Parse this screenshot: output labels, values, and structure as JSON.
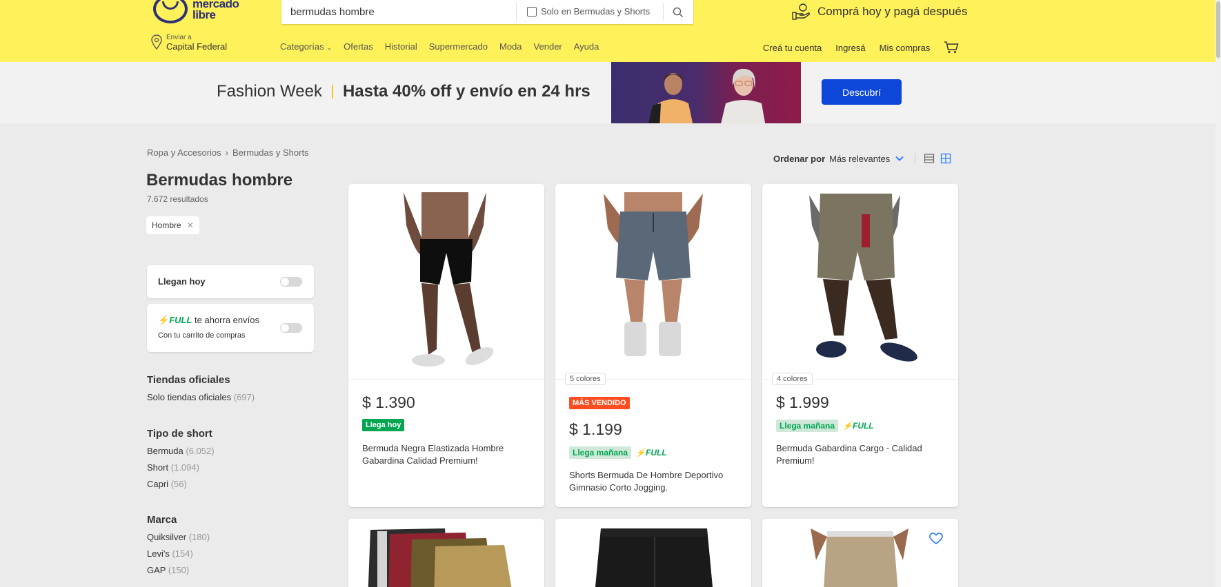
{
  "header": {
    "logo_text_line1": "mercado",
    "logo_text_line2": "libre",
    "search_value": "bermudas hombre",
    "search_filter_label": "Solo en Bermudas y Shorts",
    "promo_text": "Comprá hoy y pagá después",
    "location_label": "Enviar a",
    "location_value": "Capital Federal",
    "nav": [
      "Categorías",
      "Ofertas",
      "Historial",
      "Supermercado",
      "Moda",
      "Vender",
      "Ayuda"
    ],
    "user_nav": [
      "Creá tu cuenta",
      "Ingresá",
      "Mis compras"
    ]
  },
  "banner": {
    "title": "Fashion Week",
    "subtitle": "Hasta 40% off y envío en 24 hrs",
    "button": "Descubrí"
  },
  "breadcrumb": [
    "Ropa y Accesorios",
    "Bermudas y Shorts"
  ],
  "page_title": "Bermudas hombre",
  "results_count": "7.672 resultados",
  "applied_filter": "Hombre",
  "quick_filters": {
    "today": "Llegan hoy",
    "full_label": "FULL",
    "full_text": "te ahorra envíos",
    "full_sub": "Con tu carrito de compras"
  },
  "filter_groups": [
    {
      "title": "Tiendas oficiales",
      "items": [
        {
          "label": "Solo tiendas oficiales",
          "count": "(697)"
        }
      ]
    },
    {
      "title": "Tipo de short",
      "items": [
        {
          "label": "Bermuda",
          "count": "(6.052)"
        },
        {
          "label": "Short",
          "count": "(1.094)"
        },
        {
          "label": "Capri",
          "count": "(56)"
        }
      ]
    },
    {
      "title": "Marca",
      "items": [
        {
          "label": "Quiksilver",
          "count": "(180)"
        },
        {
          "label": "Levi's",
          "count": "(154)"
        },
        {
          "label": "GAP",
          "count": "(150)"
        }
      ]
    }
  ],
  "sort": {
    "label": "Ordenar por",
    "value": "Más relevantes"
  },
  "products": [
    {
      "price": "$ 1.390",
      "shipping": "Llega hoy",
      "title_line1": "Bermuda Negra Elastizada Hombre",
      "title_line2": "Gabardina Calidad Premium!"
    },
    {
      "price": "$ 1.199",
      "colors": "5 colores",
      "badge": "MÁS VENDIDO",
      "shipping": "Llega mañana",
      "full": "FULL",
      "title_line1": "Shorts Bermuda De Hombre Deportivo",
      "title_line2": "Gimnasio Corto Jogging."
    },
    {
      "price": "$ 1.999",
      "colors": "4 colores",
      "shipping": "Llega mañana",
      "full": "FULL",
      "title_line1": "Bermuda Gabardina Cargo - Calidad",
      "title_line2": "Premium!"
    }
  ],
  "colors": {
    "header_yellow": "#fff159",
    "accent_blue": "#3483fa",
    "button_blue": "#0d47d9",
    "green": "#00a650",
    "sold_red": "#ff4d21"
  }
}
